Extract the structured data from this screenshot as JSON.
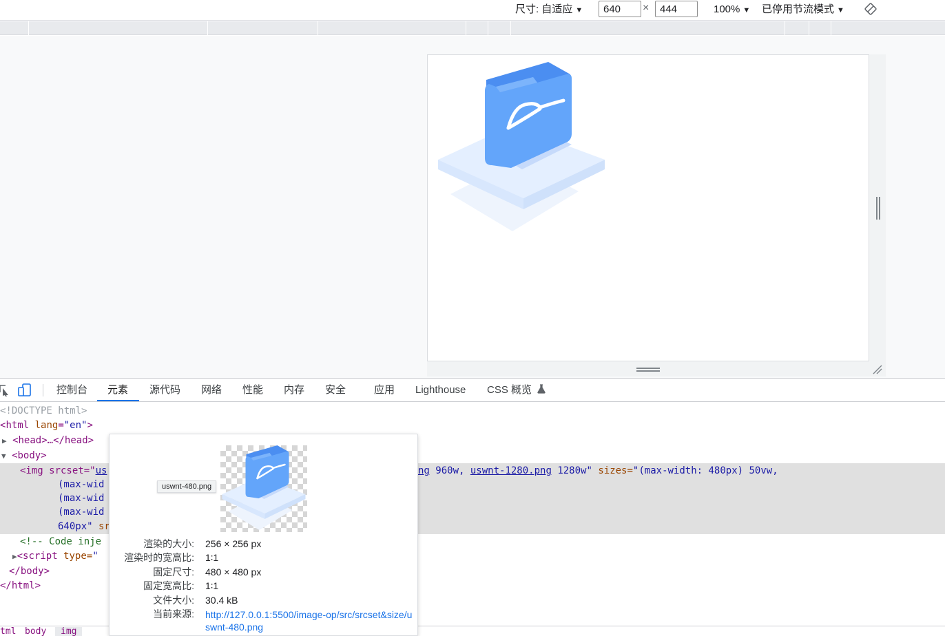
{
  "device_toolbar": {
    "dimensions_label": "尺寸: 自适应",
    "width_value": "640",
    "times": "×",
    "height_value": "444",
    "zoom": "100%",
    "throttle": "已停用节流模式",
    "caret": "▼"
  },
  "tabs": [
    {
      "label": "控制台"
    },
    {
      "label": "元素"
    },
    {
      "label": "源代码"
    },
    {
      "label": "网络"
    },
    {
      "label": "性能"
    },
    {
      "label": "内存"
    },
    {
      "label": "安全"
    },
    {
      "label": "应用"
    },
    {
      "label": "Lighthouse"
    },
    {
      "label": "CSS 概览"
    }
  ],
  "elements": {
    "doctype": "<!DOCTYPE html>",
    "html_open_tag": "html",
    "html_lang_attr": "lang",
    "html_lang_val": "\"en\"",
    "head_collapsed": "<head>…</head>",
    "body_open": "<body>",
    "img_prefix": "<img srcset=\"",
    "img_link_start": "us",
    "img_line1_link_tail": "ng",
    "img_line1_960": " 960w, ",
    "img_line1_link2": "uswnt-1280.png",
    "img_line1_1280": " 1280w\"",
    "img_sizes_attr": " sizes=",
    "img_sizes_val": "\"(max-width: 480px) 50vw,",
    "img_line2": "(max-wid",
    "img_line3": "(max-wid",
    "img_line4": "(max-wid",
    "img_line5_a": "640px\"",
    "img_line5_b": " sr",
    "comment": "<!-- Code inje",
    "script_prefix": "<script",
    "script_type_attr": " type=",
    "script_type_val": "\"",
    "body_close": "</body>",
    "html_close": "</html>"
  },
  "breadcrumbs": [
    "tml",
    "body",
    "img"
  ],
  "popup": {
    "filename": "uswnt-480.png",
    "rows": [
      {
        "key": "渲染的大小:",
        "value": "256 × 256 px"
      },
      {
        "key": "渲染时的宽高比:",
        "value": "1∶1"
      },
      {
        "key": "固定尺寸:",
        "value": "480 × 480 px"
      },
      {
        "key": "固定宽高比:",
        "value": "1∶1"
      },
      {
        "key": "文件大小:",
        "value": "30.4 kB"
      }
    ],
    "source_key": "当前来源:",
    "source_url": "http://127.0.0.1:5500/image-op/src/srcset&size/uswnt-480.png"
  },
  "colors": {
    "accent": "#1a73e8",
    "folder_blue": "#5c9ef7",
    "tag": "#881280",
    "attr": "#994500",
    "value": "#1a1aa6",
    "comment": "#236e25"
  },
  "icons": [
    "caret-down-icon",
    "rotate-icon",
    "inspect-icon",
    "device-toggle-icon",
    "flask-icon",
    "expand-triangle-icon"
  ]
}
